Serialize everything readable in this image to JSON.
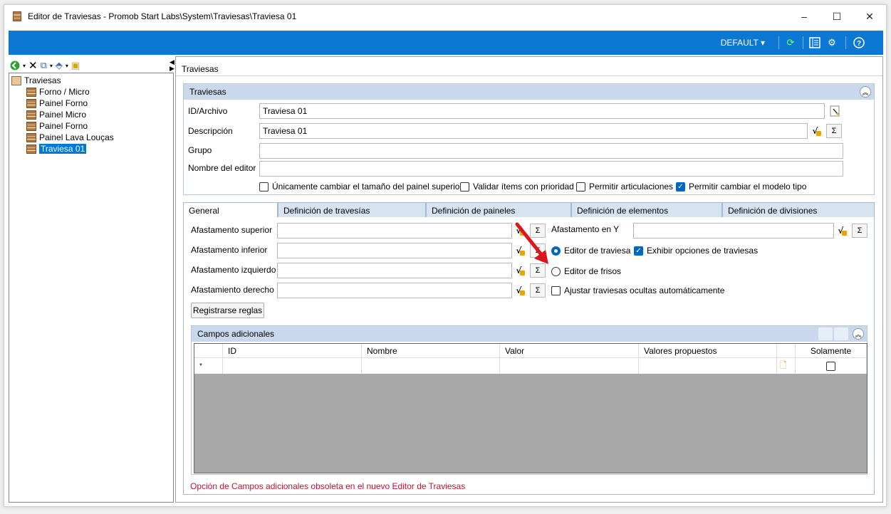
{
  "window": {
    "title": "Editor de Traviesas - Promob Start Labs\\System\\Traviesas\\Traviesa 01",
    "controls": [
      "–",
      "☐",
      "✕"
    ]
  },
  "topbar": {
    "profile_label": "DEFAULT ▾",
    "icons": [
      "refresh-icon",
      "layout-icon",
      "settings-icon",
      "help-icon"
    ]
  },
  "left_toolbar": {
    "icons": [
      "back-icon",
      "delete-icon",
      "copy-icon",
      "move-icon",
      "export-icon"
    ]
  },
  "tree": {
    "root": "Traviesas",
    "items": [
      "Forno / Micro",
      "Painel Forno",
      "Painel Micro",
      "Painel Forno",
      "Painel Lava Louças",
      "Traviesa 01"
    ],
    "selected_index": 5
  },
  "breadcrumb": "Traviesas",
  "header_group": {
    "title": "Traviesas",
    "id_label": "ID/Archivo",
    "id_value": "Traviesa 01",
    "desc_label": "Descripción",
    "desc_value": "Traviesa 01",
    "group_label": "Grupo",
    "group_value": "",
    "editor_label": "Nombre del editor",
    "editor_value": "",
    "checks": [
      {
        "label": "Únicamente cambiar el tamaño del painel superior",
        "checked": false
      },
      {
        "label": "Validar ítems con prioridad",
        "checked": false
      },
      {
        "label": "Permitir articulaciones",
        "checked": false
      },
      {
        "label": "Permitir cambiar el modelo tipo",
        "checked": true
      }
    ]
  },
  "tabs": [
    "General",
    "Definición de travesías",
    "Definición de paineles",
    "Definición de elementos",
    "Definición de divisiones"
  ],
  "general": {
    "fields": [
      {
        "label": "Afastamento superior",
        "value": ""
      },
      {
        "label": "Afastamento inferior",
        "value": ""
      },
      {
        "label": "Afastamento izquierdo",
        "value": ""
      },
      {
        "label": "Afastamiento derecho",
        "value": ""
      }
    ],
    "y_label": "Afastamento en Y",
    "y_value": "",
    "radio_editor_traviesa": "Editor de traviesa",
    "radio_editor_frisos": "Editor de frisos",
    "radio_selected": "editor_traviesa",
    "check_exhibir": "Exhibir opciones de traviesas",
    "check_exhibir_on": true,
    "check_ajustar": "Ajustar traviesas ocultas automáticamente",
    "check_ajustar_on": false,
    "register_button": "Registrarse reglas",
    "sigma": "Σ",
    "fx": "√"
  },
  "campos": {
    "title": "Campos adicionales",
    "columns": [
      "ID",
      "Nombre",
      "Valor",
      "Valores propuestos",
      "",
      "Solamente"
    ],
    "new_row_marker": "*",
    "warning": "Opción de Campos adicionales obsoleta en el nuevo Editor de Traviesas"
  }
}
